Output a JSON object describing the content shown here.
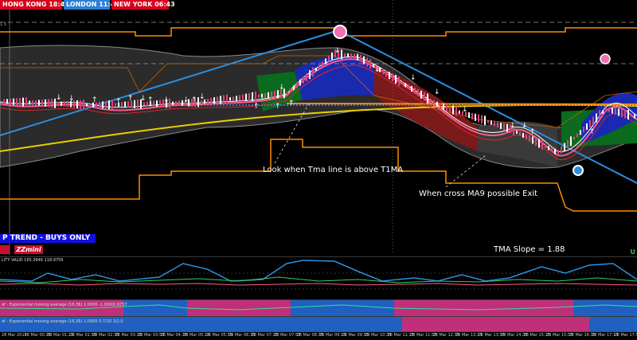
{
  "clocks": {
    "hong_kong": "HONG KONG 18:43",
    "london": "LONDON 11:43",
    "new_york": "NEW YORK 06:43"
  },
  "price_tick": "1.3",
  "annotations": {
    "tma_above": "Look when Tma line is above T1MA",
    "cross_exit": "When cross MA9 possible Exit",
    "tma_slope": "TMA Slope = 1.88"
  },
  "trend_banner": "P TREND - BUYS ONLY",
  "zz_button": "ZZmini",
  "corner_label": "U",
  "indicators": {
    "ind1_label": "LITY VALID 165.3646 118.9759",
    "ind2_label": "of - Exponential moving average (16,36) 1.0000 -1.0000(.6757",
    "ind3_label": "of - Exponential moving average (16,36) 1.0000 0.7/10 3/2.0"
  },
  "time_labels": [
    "28 Mar 2015",
    "28 Mar 00:35",
    "28 Mar 01:15",
    "28 Mar 01:55",
    "28 Mar 02:35",
    "28 Mar 03:15",
    "28 Mar 03:55",
    "28 Mar 04:35",
    "28 Mar 05:15",
    "28 Mar 05:55",
    "28 Mar 06:35",
    "28 Mar 07:15",
    "28 Mar 07:55",
    "28 Mar 08:35",
    "28 Mar 09:15",
    "28 Mar 09:55",
    "28 Mar 10:35",
    "28 Mar 11:15",
    "28 Mar 11:55",
    "28 Mar 12:35",
    "28 Mar 13:15",
    "28 Mar 13:55",
    "28 Mar 14:35",
    "28 Mar 15:15",
    "28 Mar 15:55",
    "28 Mar 16:35",
    "28 Mar 17:15",
    "28 Mar 17:55"
  ],
  "colors": {
    "bands_orange": "#ff8c00",
    "channel_blue": "#2a8fe0",
    "tma_yellow": "#e8d000",
    "ma_pink": "#ff5a8a",
    "fill_green": "#0a6a1e",
    "fill_blue": "#1a2ab0",
    "fill_red": "#7a1a1a",
    "fill_gray": "#2a2a2a"
  }
}
